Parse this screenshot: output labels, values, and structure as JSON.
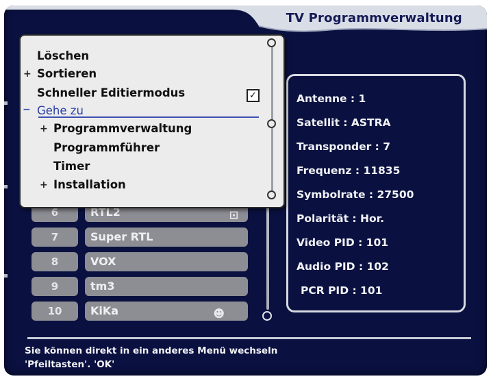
{
  "header": {
    "title": "TV Programmverwaltung"
  },
  "menu": {
    "items": [
      {
        "label": "Löschen",
        "bullet": ""
      },
      {
        "label": "Sortieren",
        "bullet": "+"
      },
      {
        "label": "Schneller Editiermodus",
        "bullet": "",
        "checked": true
      },
      {
        "label": "Gehe zu",
        "bullet": "−",
        "selected": true
      },
      {
        "label": "Programmverwaltung",
        "bullet": "+"
      },
      {
        "label": "Programmführer",
        "bullet": ""
      },
      {
        "label": "Timer",
        "bullet": ""
      },
      {
        "label": "Installation",
        "bullet": "+"
      }
    ],
    "checkbox_mark": "✓"
  },
  "channels": [
    {
      "number": "6",
      "name": "RTL2",
      "icon": "lock-icon"
    },
    {
      "number": "7",
      "name": "Super RTL",
      "icon": ""
    },
    {
      "number": "8",
      "name": "VOX",
      "icon": ""
    },
    {
      "number": "9",
      "name": "tm3",
      "icon": ""
    },
    {
      "number": "10",
      "name": "KiKa",
      "icon": "smiley-icon"
    }
  ],
  "info": {
    "lines": [
      "Antenne : 1",
      "Satellit : ASTRA",
      "Transponder : 7",
      "Frequenz : 11835",
      "Symbolrate : 27500",
      "Polarität : Hor.",
      "Video PID : 101",
      "Audio PID : 102",
      "PCR  PID : 101"
    ]
  },
  "status": {
    "line1": "Sie können direkt in ein anderes Menü wechseln",
    "line2": "'Pfeiltasten'. 'OK'"
  },
  "colors": {
    "background": "#0a1140",
    "panel": "#8d8d94",
    "menu_bg": "#ececec",
    "title_text": "#141a55",
    "selection": "#3b4fb0"
  }
}
